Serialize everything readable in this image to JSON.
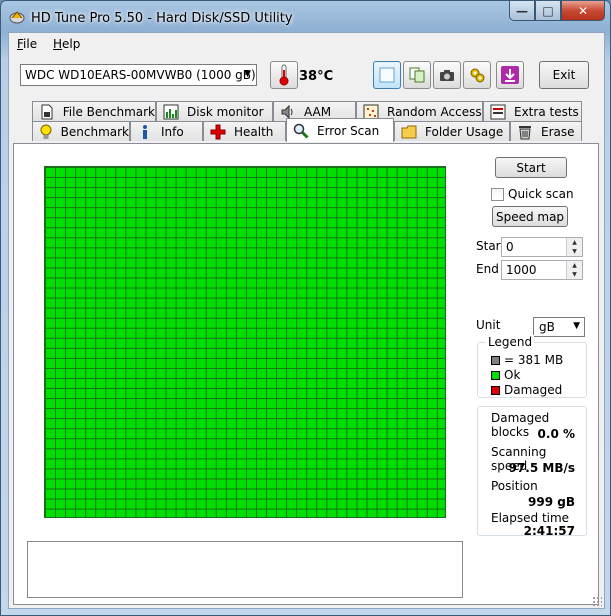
{
  "window": {
    "title": "HD Tune Pro 5.50 - Hard Disk/SSD Utility",
    "icons": {
      "app": "hd-tune-icon",
      "min": "minimize-icon",
      "max": "maximize-icon",
      "close": "close-icon"
    }
  },
  "menu": {
    "file": "File",
    "help": "Help"
  },
  "toolbar": {
    "drive": "WDC WD10EARS-00MVWB0 (1000 gB)",
    "temperature": "38°C",
    "exit_label": "Exit",
    "icons": [
      "thermometer-icon",
      "blank-page-icon",
      "copy-icon",
      "camera-icon",
      "settings-gear-icon",
      "save-download-icon"
    ]
  },
  "tabs": {
    "row1": [
      "File Benchmark",
      "Disk monitor",
      "AAM",
      "Random Access",
      "Extra tests"
    ],
    "row2": [
      "Benchmark",
      "Info",
      "Health",
      "Error Scan",
      "Folder Usage",
      "Erase"
    ],
    "selected": "Error Scan"
  },
  "error_scan": {
    "start_button": "Start",
    "quick_scan_label": "Quick scan",
    "quick_scan_checked": false,
    "speed_map_button": "Speed map",
    "start_label": "Start",
    "start_value": "0",
    "end_label": "End",
    "end_value": "1000",
    "unit_label": "Unit",
    "unit_value": "gB",
    "legend": {
      "title": "Legend",
      "block": "= 381 MB",
      "ok": "Ok",
      "damaged": "Damaged",
      "colors": {
        "block": "#808080",
        "ok": "#00e000",
        "damaged": "#e00000"
      }
    },
    "stats": {
      "damaged_blocks_label": "Damaged blocks",
      "damaged_blocks_value": "0.0 %",
      "scanning_speed_label": "Scanning speed",
      "scanning_speed_value": "97.5 MB/s",
      "position_label": "Position",
      "position_value": "999 gB",
      "elapsed_label": "Elapsed time",
      "elapsed_value": "2:41:57"
    },
    "grid_color": "#00e000"
  }
}
